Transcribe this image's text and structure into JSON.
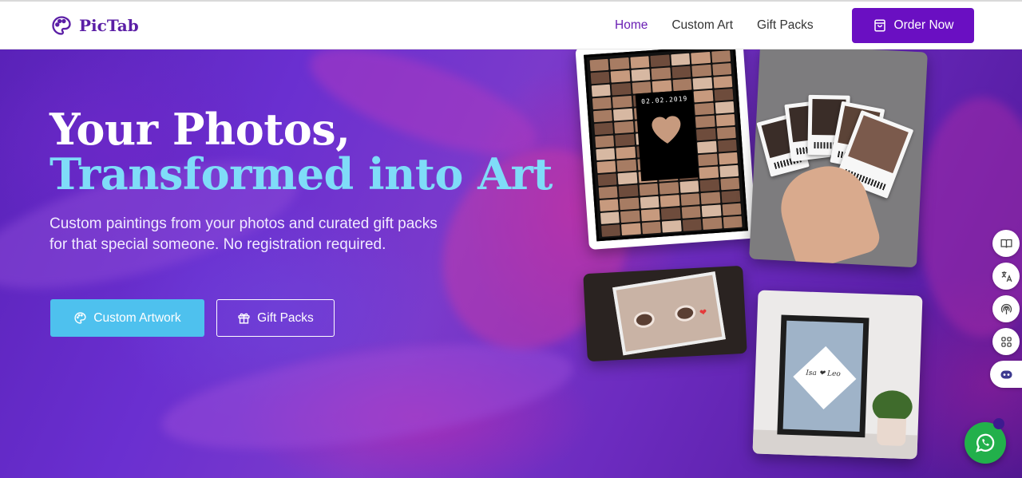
{
  "brand": {
    "name": "PicTab"
  },
  "nav": {
    "links": [
      {
        "label": "Home",
        "active": true
      },
      {
        "label": "Custom Art",
        "active": false
      },
      {
        "label": "Gift Packs",
        "active": false
      }
    ],
    "order_label": "Order Now"
  },
  "hero": {
    "title_line1": "Your Photos,",
    "title_line2": "Transformed into Art",
    "subtitle": "Custom paintings from your photos and curated gift packs for that special someone. No registration required.",
    "primary_button": "Custom Artwork",
    "secondary_button": "Gift Packs"
  },
  "gallery": {
    "collage_date": "02.02.2019",
    "frame_text": "Isa ❤ Leo"
  },
  "colors": {
    "brand_purple": "#6a0fc2",
    "title_accent": "#7fdcf8",
    "primary_button": "#4ec1ee",
    "whatsapp": "#22b04b"
  },
  "side_tools": [
    {
      "icon": "book-open-icon"
    },
    {
      "icon": "translate-icon"
    },
    {
      "icon": "podcast-icon"
    },
    {
      "icon": "apps-grid-icon"
    },
    {
      "icon": "assistant-bot-icon"
    }
  ]
}
